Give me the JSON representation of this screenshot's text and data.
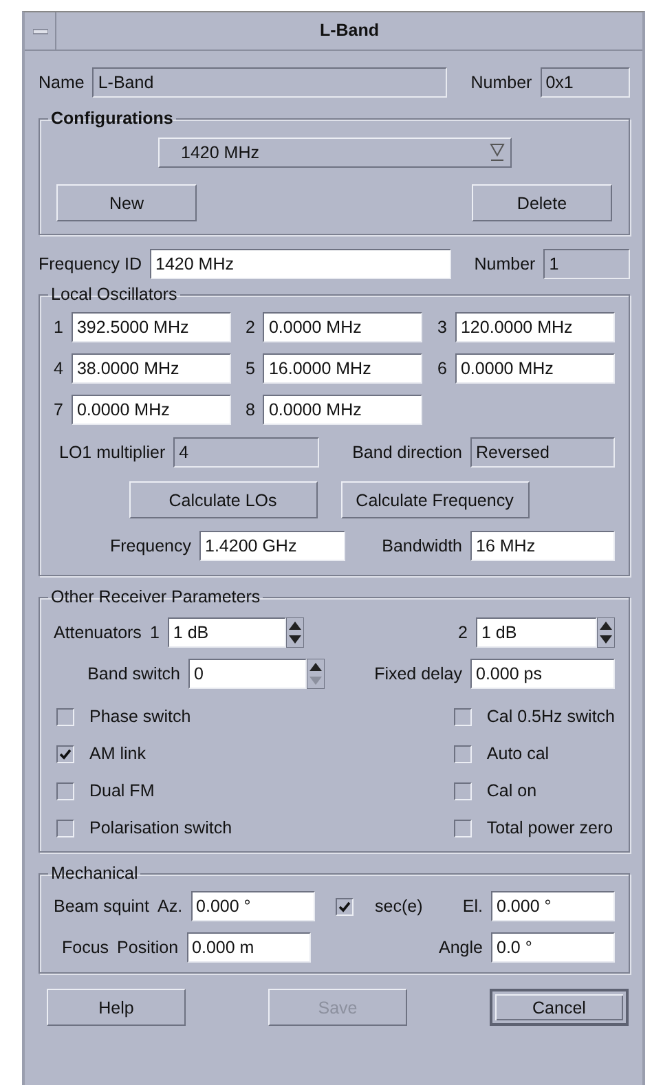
{
  "window": {
    "title": "L-Band"
  },
  "name": {
    "label": "Name",
    "value": "L-Band",
    "read_only": true
  },
  "number": {
    "label": "Number",
    "value": "0x1",
    "read_only": true
  },
  "configurations": {
    "title": "Configurations",
    "selected": "1420 MHz",
    "buttons": [
      {
        "label": "New",
        "disabled": false
      },
      {
        "label": "Delete",
        "disabled": false
      }
    ]
  },
  "frequency_id": {
    "label": "Frequency ID",
    "value": "1420 MHz",
    "read_only": false
  },
  "frequency_number": {
    "label": "Number",
    "value": "1",
    "read_only": true
  },
  "local_oscillators": {
    "title": "Local Oscillators",
    "oscillators": [
      {
        "label": "1",
        "value": "392.5000 MHz",
        "read_only": false
      },
      {
        "label": "2",
        "value": "0.0000 MHz",
        "read_only": false
      },
      {
        "label": "3",
        "value": "120.0000 MHz",
        "read_only": false
      },
      {
        "label": "4",
        "value": "38.0000 MHz",
        "read_only": false
      },
      {
        "label": "5",
        "value": "16.0000 MHz",
        "read_only": false
      },
      {
        "label": "6",
        "value": "0.0000 MHz",
        "read_only": false
      },
      {
        "label": "7",
        "value": "0.0000 MHz",
        "read_only": false
      },
      {
        "label": "8",
        "value": "0.0000 MHz",
        "read_only": false
      }
    ],
    "lo1_multiplier": {
      "label": "LO1 multiplier",
      "value": "4",
      "read_only": true
    },
    "band_direction": {
      "label": "Band direction",
      "value": "Reversed",
      "read_only": true
    },
    "buttons": [
      {
        "label": "Calculate LOs",
        "disabled": false
      },
      {
        "label": "Calculate Frequency",
        "disabled": false
      }
    ],
    "frequency": {
      "label": "Frequency",
      "value": "1.4200 GHz",
      "read_only": false
    },
    "bandwidth": {
      "label": "Bandwidth",
      "value": "16 MHz",
      "read_only": false
    }
  },
  "other_receiver_parameters": {
    "title": "Other Receiver Parameters",
    "attenuators_label": "Attenuators",
    "attenuators": [
      {
        "label": "1",
        "value": "1 dB",
        "read_only": false,
        "down_disabled": false
      },
      {
        "label": "2",
        "value": "1 dB",
        "read_only": false,
        "down_disabled": false
      }
    ],
    "band_switch": {
      "label": "Band switch",
      "value": "0",
      "read_only": false,
      "down_disabled": true
    },
    "fixed_delay": {
      "label": "Fixed delay",
      "value": "0.000 ps",
      "read_only": false
    },
    "switches": [
      {
        "label": "Phase switch",
        "checked": false
      },
      {
        "label": "Cal 0.5Hz switch",
        "checked": false
      },
      {
        "label": "AM link",
        "checked": true
      },
      {
        "label": "Auto cal",
        "checked": false
      },
      {
        "label": "Dual FM",
        "checked": false
      },
      {
        "label": "Cal on",
        "checked": false
      },
      {
        "label": "Polarisation switch",
        "checked": false
      },
      {
        "label": "Total power zero",
        "checked": false
      }
    ]
  },
  "mechanical": {
    "title": "Mechanical",
    "beam_squint_label": "Beam squint",
    "azimuth": {
      "label": "Az.",
      "value": "0.000 °",
      "read_only": false
    },
    "sec_e": {
      "label": "sec(e)",
      "checked": true
    },
    "elevation": {
      "label": "El.",
      "value": "0.000 °",
      "read_only": false
    },
    "focus_label": "Focus",
    "position": {
      "label": "Position",
      "value": "0.000 m",
      "read_only": false
    },
    "angle": {
      "label": "Angle",
      "value": "0.0 °",
      "read_only": false
    }
  },
  "buttons": [
    {
      "label": "Help",
      "disabled": false,
      "default": false
    },
    {
      "label": "Save",
      "disabled": true,
      "default": false
    },
    {
      "label": "Cancel",
      "disabled": false,
      "default": true
    }
  ]
}
